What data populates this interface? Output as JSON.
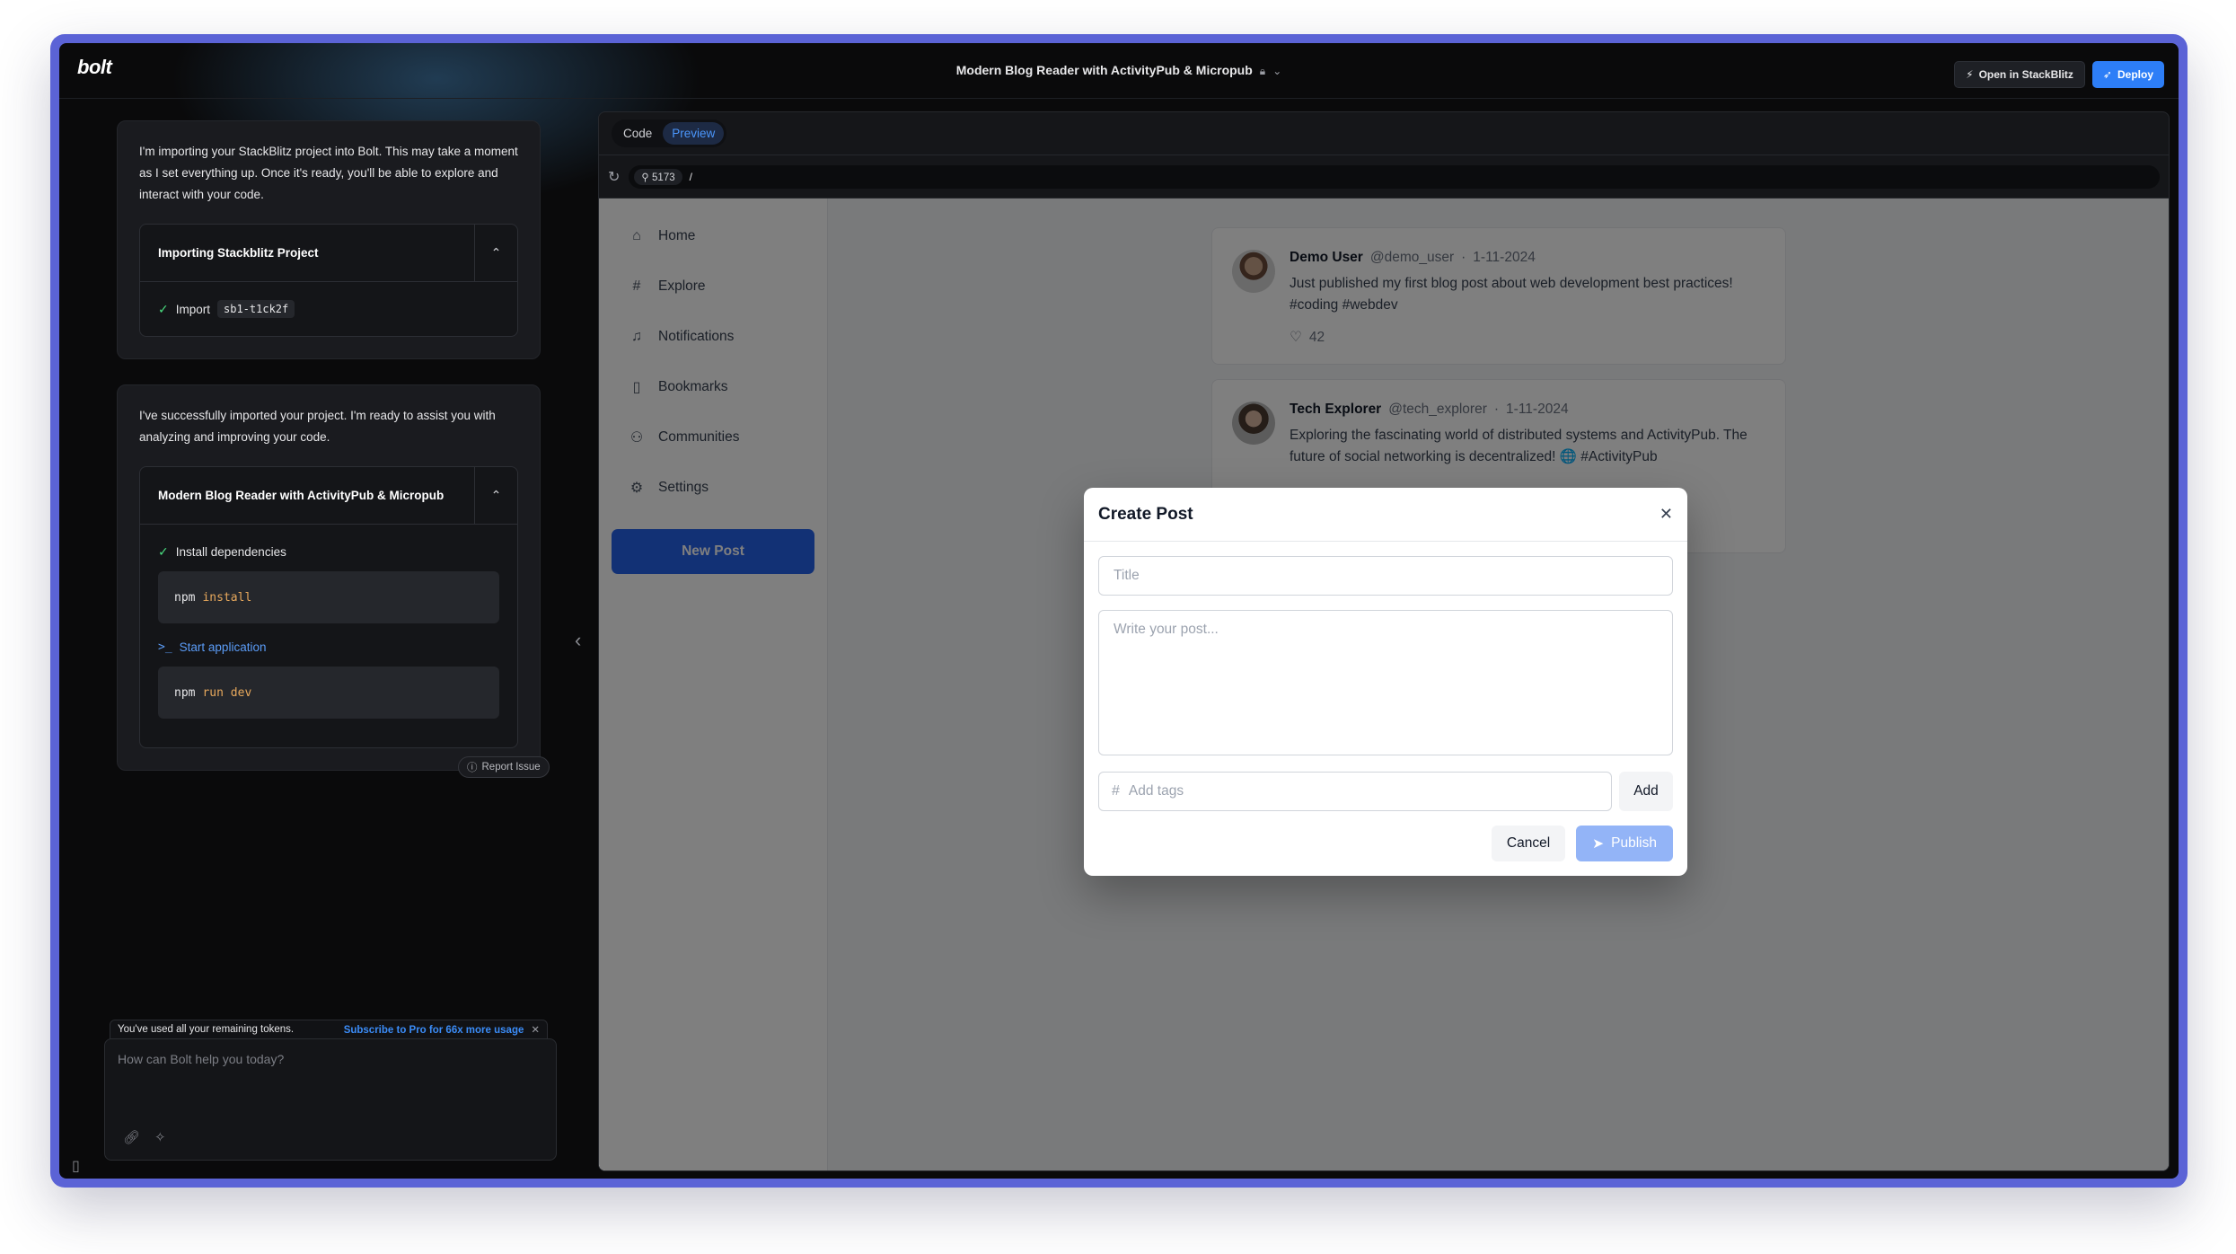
{
  "app": {
    "logo": "bolt",
    "project_title": "Modern Blog Reader with ActivityPub & Micropub"
  },
  "top_actions": {
    "open_stackblitz": "Open in StackBlitz",
    "deploy": "Deploy"
  },
  "chat": {
    "message1": "I'm importing your StackBlitz project into Bolt. This may take a moment as I set everything up. Once it's ready, you'll be able to explore and interact with your code.",
    "artifact1": {
      "title": "Importing Stackblitz Project",
      "step_label": "Import",
      "step_code": "sb1-t1ck2f"
    },
    "message2": "I've successfully imported your project. I'm ready to assist you with analyzing and improving your code.",
    "artifact2": {
      "title": "Modern Blog Reader with ActivityPub & Micropub",
      "step1": "Install dependencies",
      "cmd1_kw": "npm",
      "cmd1_arg": "install",
      "step2": "Start application",
      "cmd2_kw": "npm",
      "cmd2_arg": "run dev"
    },
    "report_issue": "Report Issue",
    "token_msg": "You've used all your remaining tokens.",
    "token_sub": "Subscribe to Pro for 66x more usage",
    "input_placeholder": "How can Bolt help you today?"
  },
  "workbench": {
    "tabs": [
      "Code",
      "Preview"
    ],
    "active_tab": "Preview",
    "port": "5173",
    "path": "/"
  },
  "preview_app": {
    "nav": [
      {
        "label": "Home",
        "icon": "home-icon"
      },
      {
        "label": "Explore",
        "icon": "hash-icon"
      },
      {
        "label": "Notifications",
        "icon": "bell-icon"
      },
      {
        "label": "Bookmarks",
        "icon": "bookmark-icon"
      },
      {
        "label": "Communities",
        "icon": "users-icon"
      },
      {
        "label": "Settings",
        "icon": "gear-icon"
      }
    ],
    "new_post": "New Post",
    "posts": [
      {
        "name": "Demo User",
        "handle": "@demo_user",
        "date": "1-11-2024",
        "body": "Just published my first blog post about web development best practices! #coding #webdev",
        "likes": "42"
      },
      {
        "name": "Tech Explorer",
        "handle": "@tech_explorer",
        "date": "1-11-2024",
        "body": "Exploring the fascinating world of distributed systems and ActivityPub. The future of social networking is decentralized! 🌐 #ActivityPub",
        "likes": ""
      }
    ],
    "modal": {
      "title": "Create Post",
      "title_placeholder": "Title",
      "body_placeholder": "Write your post...",
      "tags_placeholder": "Add tags",
      "add": "Add",
      "cancel": "Cancel",
      "publish": "Publish"
    }
  },
  "colors": {
    "accent": "#2d7ef7",
    "frame": "#5b63d6",
    "success": "#4ade80"
  }
}
